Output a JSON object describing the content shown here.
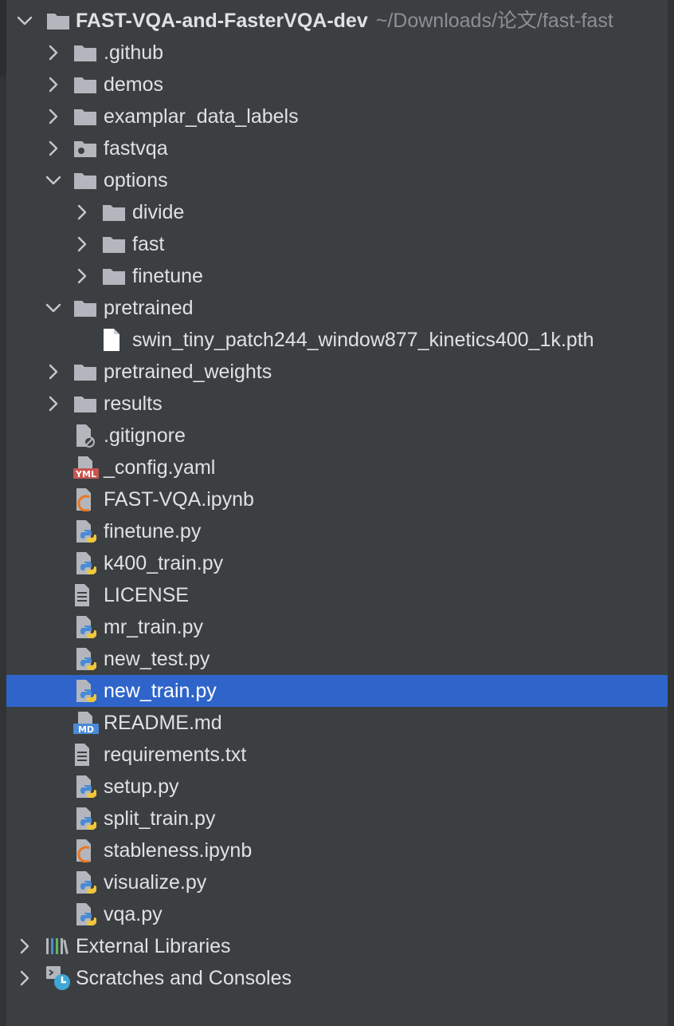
{
  "project_tree": {
    "root": {
      "name": "FAST-VQA-and-FasterVQA-dev",
      "path": "~/Downloads/论文/fast-fast"
    },
    "items": [
      {
        "label": ".github",
        "type": "folder",
        "expanded": false,
        "depth": 1
      },
      {
        "label": "demos",
        "type": "folder",
        "expanded": false,
        "depth": 1
      },
      {
        "label": "examplar_data_labels",
        "type": "folder",
        "expanded": false,
        "depth": 1
      },
      {
        "label": "fastvqa",
        "type": "package-folder",
        "expanded": false,
        "depth": 1
      },
      {
        "label": "options",
        "type": "folder",
        "expanded": true,
        "depth": 1
      },
      {
        "label": "divide",
        "type": "folder",
        "expanded": false,
        "depth": 2
      },
      {
        "label": "fast",
        "type": "folder",
        "expanded": false,
        "depth": 2
      },
      {
        "label": "finetune",
        "type": "folder",
        "expanded": false,
        "depth": 2
      },
      {
        "label": "pretrained",
        "type": "folder",
        "expanded": true,
        "depth": 1
      },
      {
        "label": "swin_tiny_patch244_window877_kinetics400_1k.pth",
        "type": "file",
        "depth": 2
      },
      {
        "label": "pretrained_weights",
        "type": "folder",
        "expanded": false,
        "depth": 1
      },
      {
        "label": "results",
        "type": "folder",
        "expanded": false,
        "depth": 1
      },
      {
        "label": ".gitignore",
        "type": "gitignore",
        "depth": 1
      },
      {
        "label": "_config.yaml",
        "type": "yaml",
        "depth": 1
      },
      {
        "label": "FAST-VQA.ipynb",
        "type": "notebook",
        "depth": 1
      },
      {
        "label": "finetune.py",
        "type": "python",
        "depth": 1
      },
      {
        "label": "k400_train.py",
        "type": "python",
        "depth": 1
      },
      {
        "label": "LICENSE",
        "type": "text",
        "depth": 1
      },
      {
        "label": "mr_train.py",
        "type": "python",
        "depth": 1
      },
      {
        "label": "new_test.py",
        "type": "python",
        "depth": 1
      },
      {
        "label": "new_train.py",
        "type": "python",
        "depth": 1,
        "selected": true
      },
      {
        "label": "README.md",
        "type": "markdown",
        "depth": 1
      },
      {
        "label": "requirements.txt",
        "type": "text",
        "depth": 1
      },
      {
        "label": "setup.py",
        "type": "python",
        "depth": 1
      },
      {
        "label": "split_train.py",
        "type": "python",
        "depth": 1
      },
      {
        "label": "stableness.ipynb",
        "type": "notebook",
        "depth": 1
      },
      {
        "label": "visualize.py",
        "type": "python",
        "depth": 1
      },
      {
        "label": "vqa.py",
        "type": "python",
        "depth": 1
      }
    ],
    "footer_items": [
      {
        "label": "External Libraries",
        "type": "libraries",
        "expanded": false
      },
      {
        "label": "Scratches and Consoles",
        "type": "scratches",
        "expanded": false
      }
    ]
  },
  "icon_badges": {
    "yaml": "YML",
    "markdown": "MD"
  },
  "colors": {
    "background": "#3c3f41",
    "selection": "#2f65ca",
    "folder": "#b3b7bd",
    "text": "#dfe1e5",
    "path_text": "#8c8f94",
    "python_blue": "#4a8ad6",
    "python_yellow": "#f0c63a",
    "notebook_orange": "#e87722",
    "yaml_red": "#c75450",
    "markdown_blue": "#4a8ad6"
  }
}
